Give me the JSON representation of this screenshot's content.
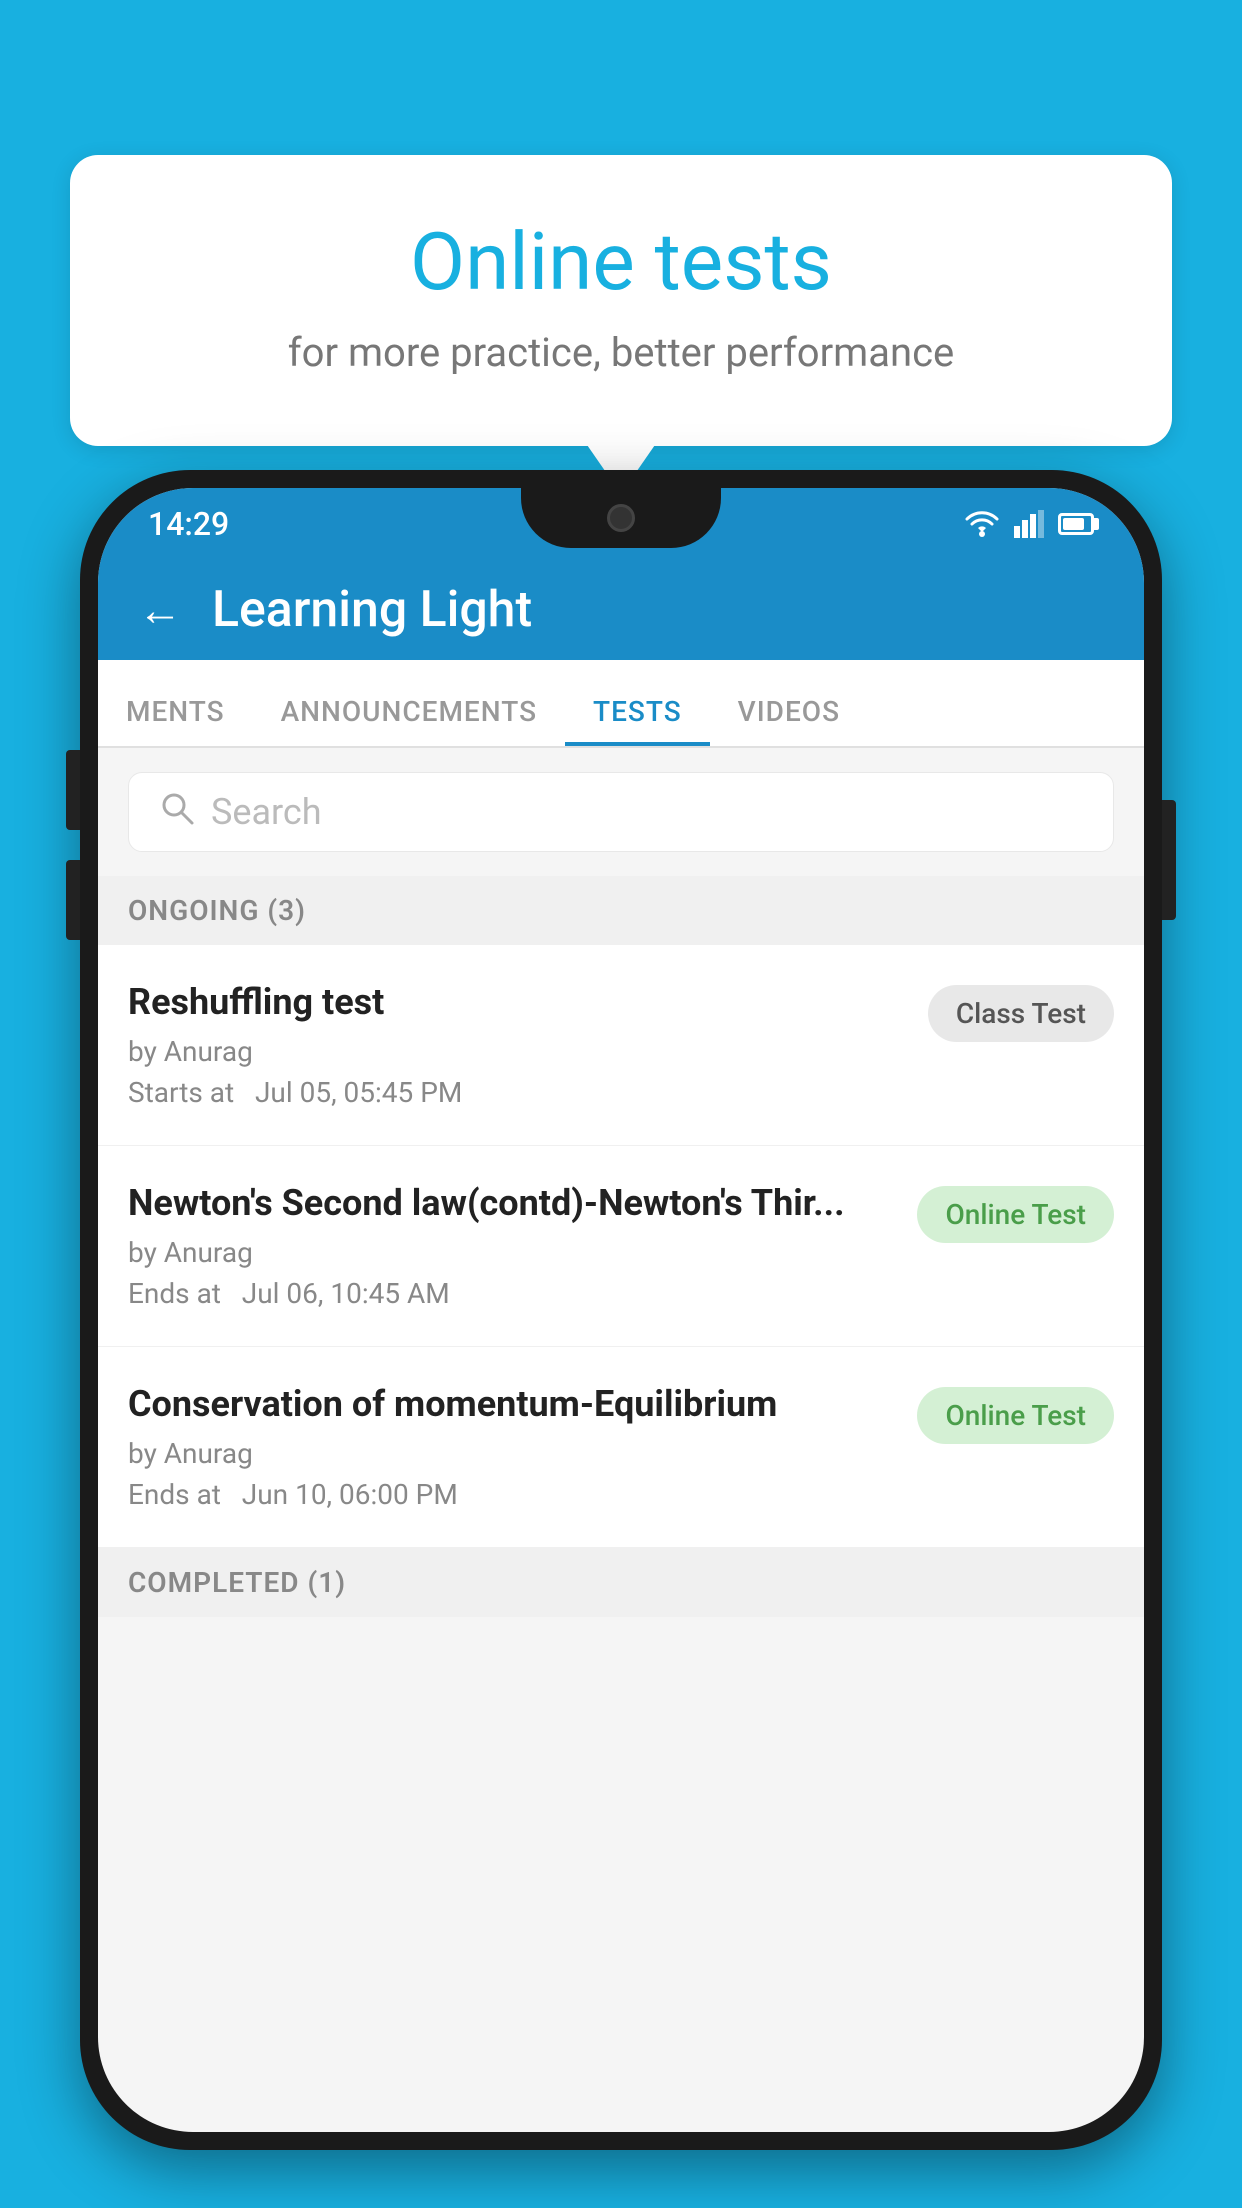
{
  "background": {
    "color": "#18b0e0"
  },
  "promo": {
    "title": "Online tests",
    "subtitle": "for more practice, better performance"
  },
  "status_bar": {
    "time": "14:29",
    "wifi": "wifi",
    "signal": "signal",
    "battery": "battery"
  },
  "app_header": {
    "title": "Learning Light",
    "back_label": "←"
  },
  "tabs": [
    {
      "label": "MENTS",
      "active": false
    },
    {
      "label": "ANNOUNCEMENTS",
      "active": false
    },
    {
      "label": "TESTS",
      "active": true
    },
    {
      "label": "VIDEOS",
      "active": false
    }
  ],
  "search": {
    "placeholder": "Search"
  },
  "ongoing_section": {
    "label": "ONGOING (3)"
  },
  "test_items": [
    {
      "name": "Reshuffling test",
      "author": "by Anurag",
      "date_label": "Starts at",
      "date": "Jul 05, 05:45 PM",
      "badge": "Class Test",
      "badge_type": "class"
    },
    {
      "name": "Newton's Second law(contd)-Newton's Thir...",
      "author": "by Anurag",
      "date_label": "Ends at",
      "date": "Jul 06, 10:45 AM",
      "badge": "Online Test",
      "badge_type": "online"
    },
    {
      "name": "Conservation of momentum-Equilibrium",
      "author": "by Anurag",
      "date_label": "Ends at",
      "date": "Jun 10, 06:00 PM",
      "badge": "Online Test",
      "badge_type": "online"
    }
  ],
  "completed_section": {
    "label": "COMPLETED (1)"
  }
}
